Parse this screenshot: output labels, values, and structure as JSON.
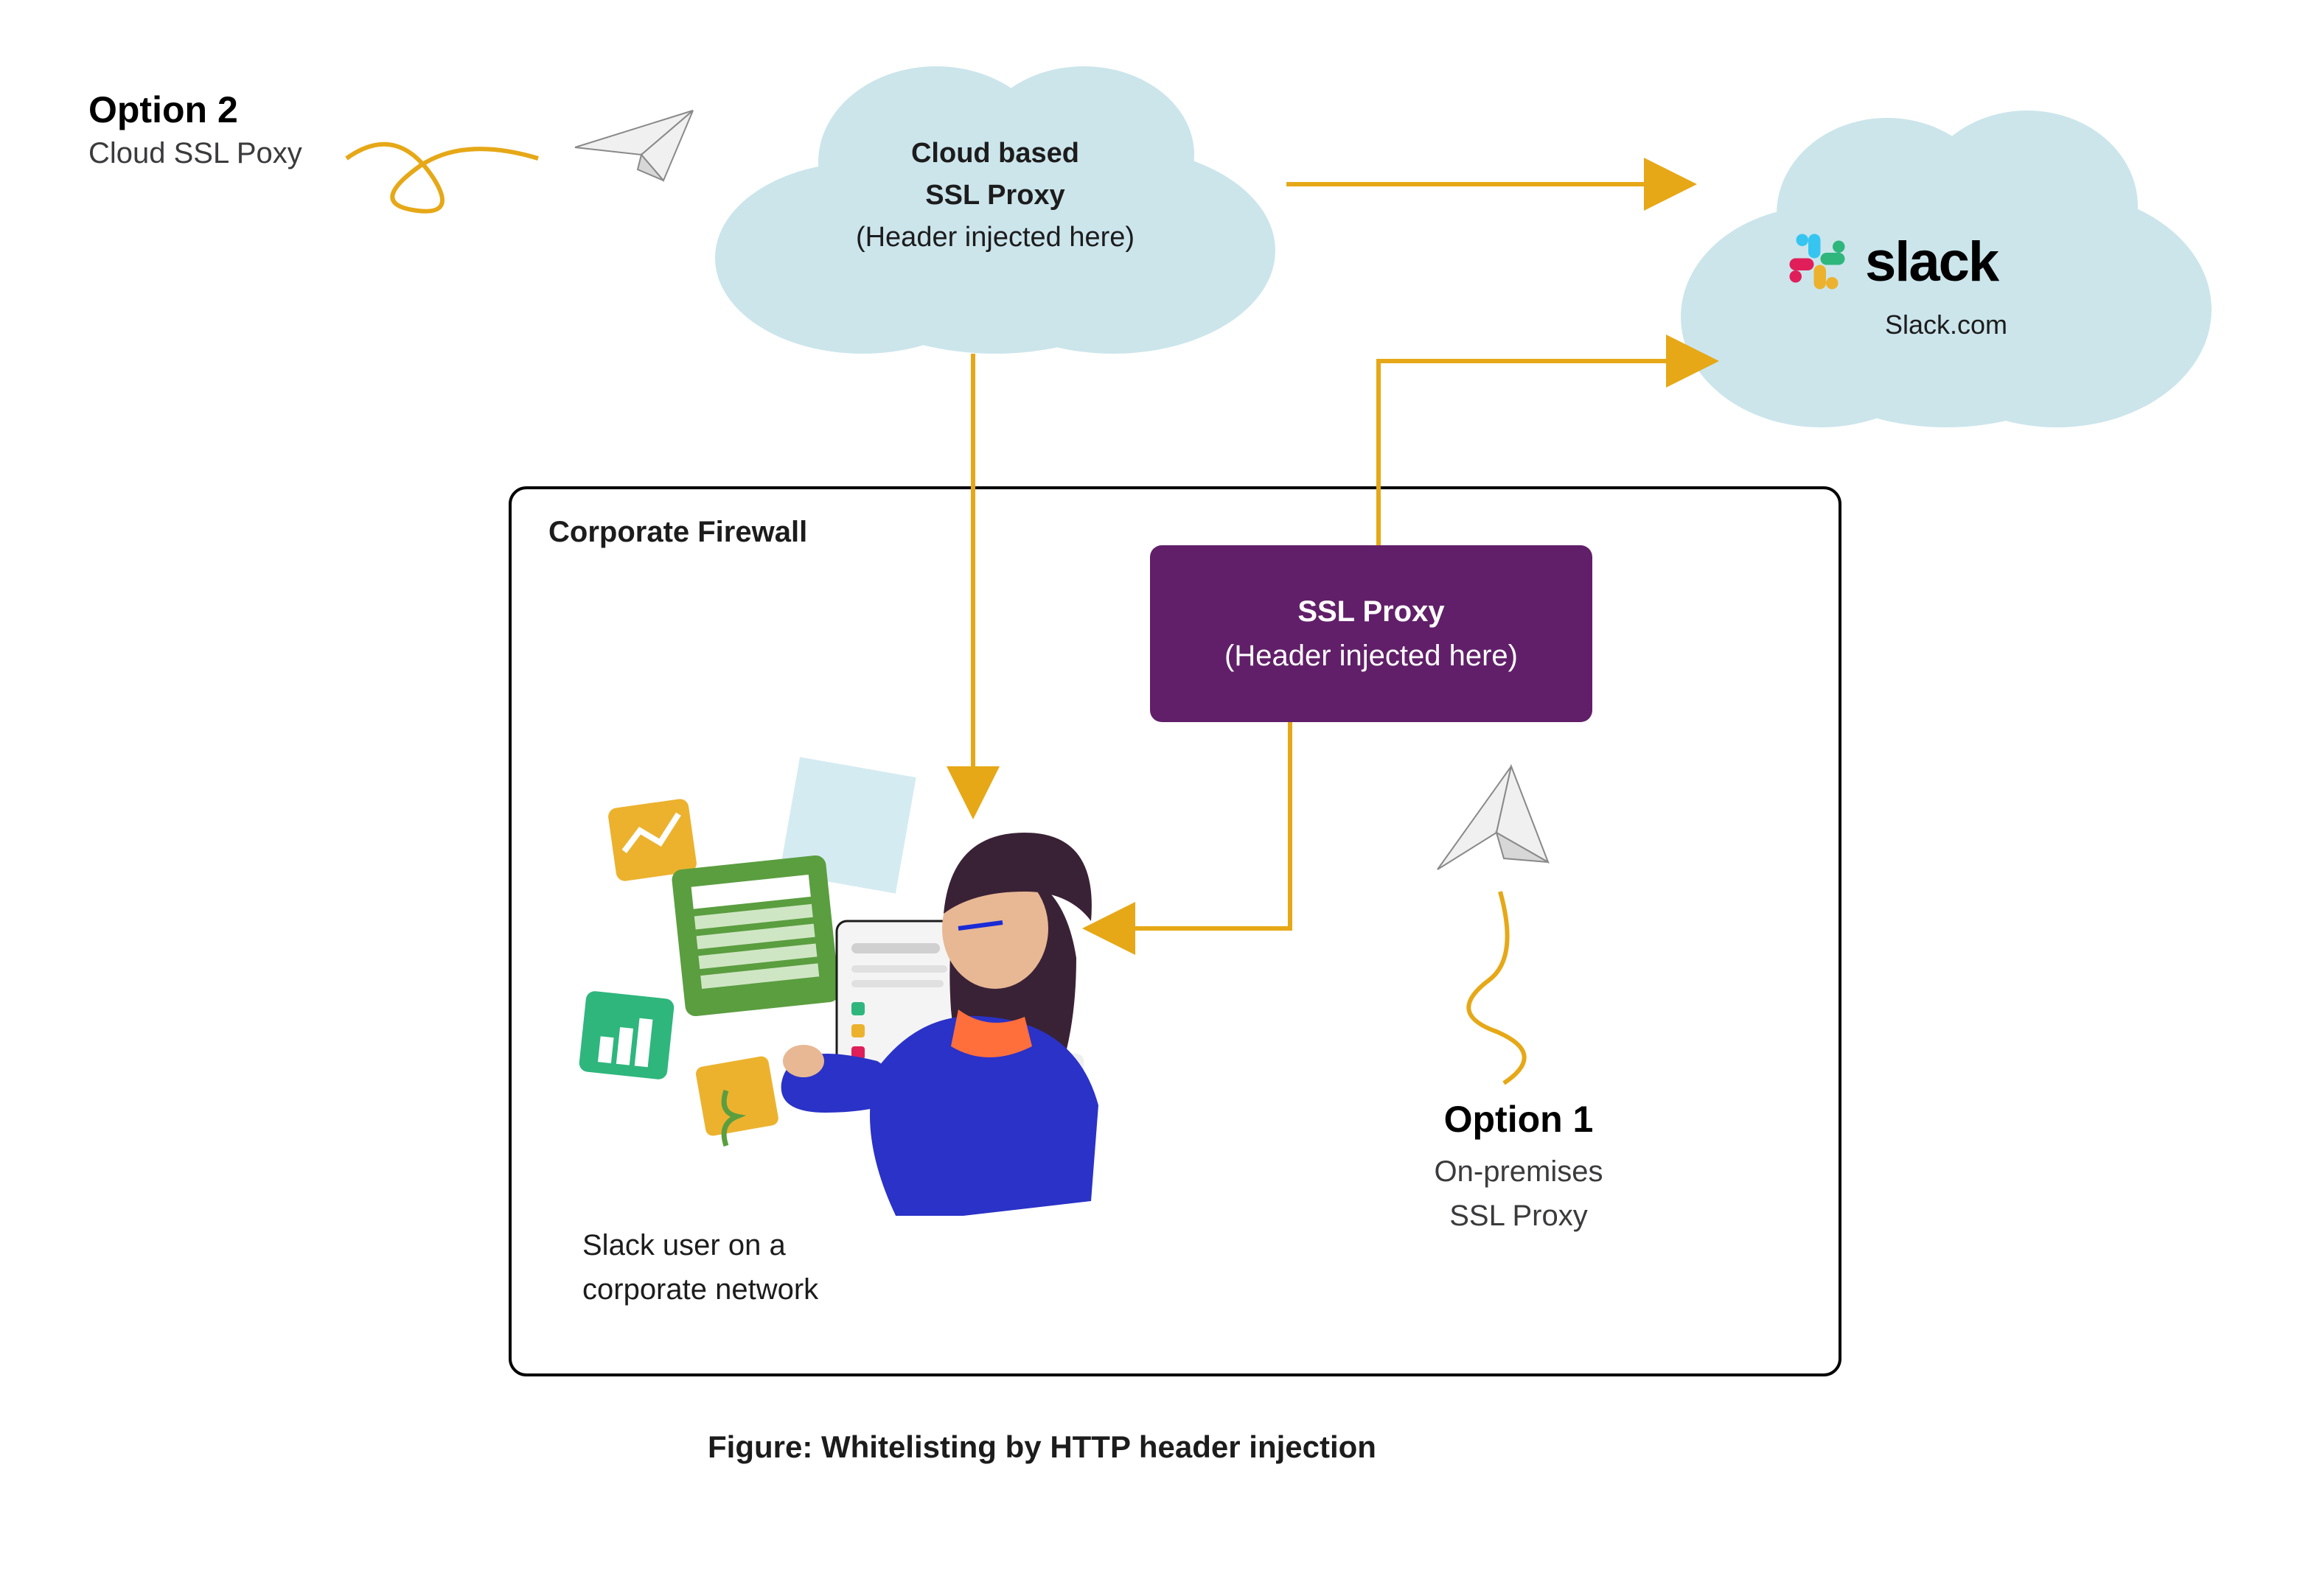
{
  "option2": {
    "title": "Option 2",
    "subtitle": "Cloud SSL Poxy"
  },
  "cloud_proxy": {
    "line1": "Cloud based",
    "line2": "SSL Proxy",
    "line3": "(Header injected here)"
  },
  "slack_cloud": {
    "brand": "slack",
    "domain": "Slack.com"
  },
  "firewall": {
    "title": "Corporate Firewall"
  },
  "purple_proxy": {
    "line1": "SSL Proxy",
    "line2": "(Header injected here)"
  },
  "option1": {
    "title": "Option 1",
    "sub1": "On-premises",
    "sub2": "SSL Proxy"
  },
  "user_caption": {
    "line1": "Slack user on a",
    "line2": "corporate network"
  },
  "figure_caption": "Figure: Whitelisting by HTTP header injection",
  "colors": {
    "cloud": "#cbe5eb",
    "purple": "#611f69",
    "arrow": "#e6a817",
    "slack_green": "#2eb67d",
    "slack_blue": "#36c5f0",
    "slack_red": "#e01e5a",
    "slack_yellow": "#ecb22e"
  }
}
